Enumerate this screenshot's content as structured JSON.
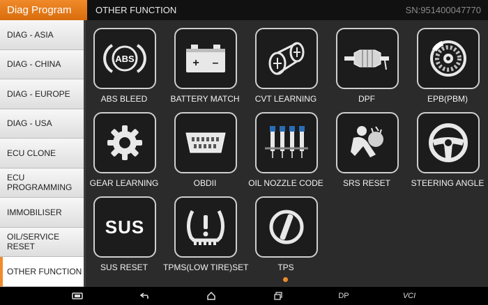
{
  "header": {
    "app_title": "Diag Program",
    "page_title": "OTHER FUNCTION",
    "serial": "SN:951400047770"
  },
  "sidebar": {
    "items": [
      {
        "label": "DIAG - ASIA"
      },
      {
        "label": "DIAG - CHINA"
      },
      {
        "label": "DIAG - EUROPE"
      },
      {
        "label": "DIAG - USA"
      },
      {
        "label": "ECU CLONE"
      },
      {
        "label": "ECU PROGRAMMING"
      },
      {
        "label": "IMMOBILISER"
      },
      {
        "label": "OIL/SERVICE RESET"
      },
      {
        "label": "OTHER FUNCTION"
      }
    ],
    "active_index": 8
  },
  "functions": {
    "abs_bleed": {
      "label": "ABS BLEED",
      "icon_text": "ABS",
      "icon": "abs-icon"
    },
    "battery_match": {
      "label": "BATTERY MATCH",
      "icon_plus": "+",
      "icon_minus": "–",
      "icon": "battery-icon"
    },
    "cvt_learning": {
      "label": "CVT LEARNING",
      "icon": "cvt-pulley-icon"
    },
    "dpf": {
      "label": "DPF",
      "icon": "particulate-filter-icon"
    },
    "epb": {
      "label": "EPB(PBM)",
      "icon": "brake-disc-icon"
    },
    "gear_learning": {
      "label": "GEAR LEARNING",
      "icon": "gear-icon"
    },
    "obdii": {
      "label": "OBDII",
      "icon": "obd-connector-icon"
    },
    "oil_nozzle": {
      "label": "OIL NOZZLE CODE",
      "icon": "injector-icon"
    },
    "srs_reset": {
      "label": "SRS RESET",
      "icon": "airbag-icon"
    },
    "steering_angle": {
      "label": "STEERING ANGLE",
      "icon": "steering-wheel-icon"
    },
    "sus_reset": {
      "label": "SUS RESET",
      "icon_text": "SUS",
      "icon": "suspension-icon"
    },
    "tpms": {
      "label": "TPMS(LOW TIRE)SET",
      "icon": "tire-pressure-icon"
    },
    "tps": {
      "label": "TPS",
      "icon": "throttle-position-icon"
    }
  },
  "navbar": {
    "dp_label": "DP",
    "vci_label": "VCI"
  },
  "colors": {
    "accent": "#f08a2a",
    "tile_border": "#cfcfcf",
    "background": "#2b2b2b"
  }
}
